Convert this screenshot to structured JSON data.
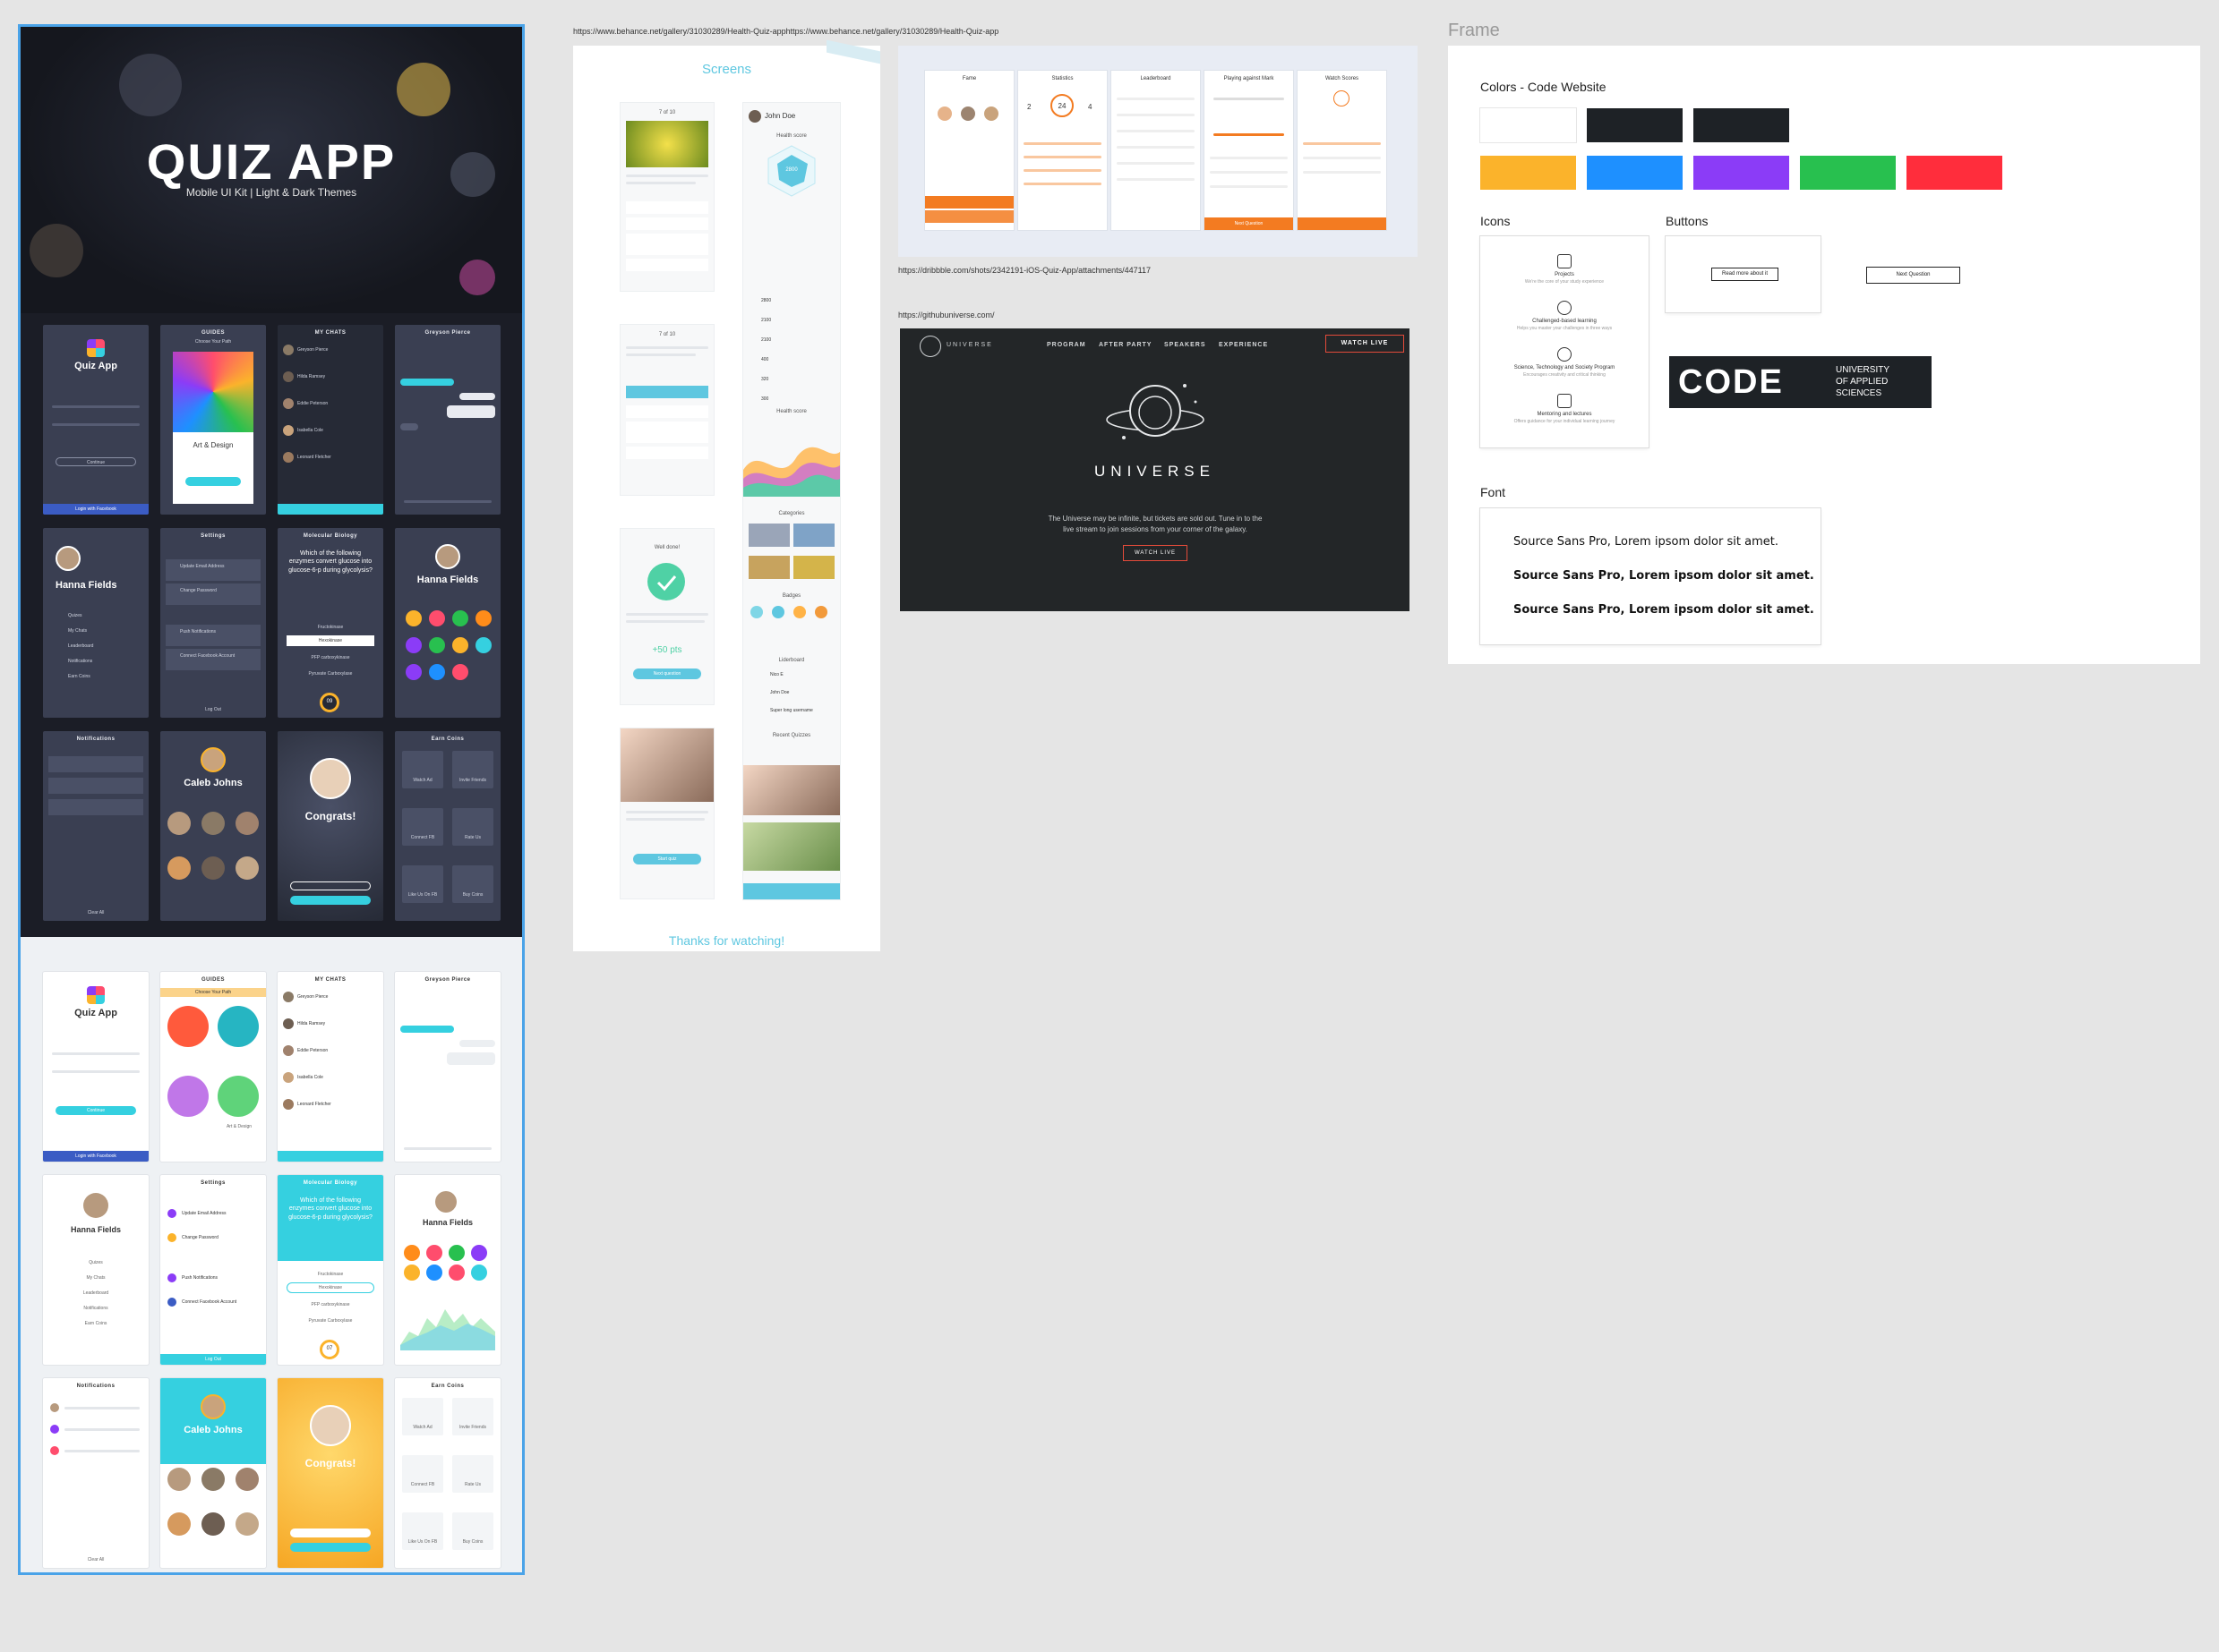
{
  "quiz_board": {
    "title": "QUIZ APP",
    "subtitle": "Mobile UI Kit | Light & Dark Themes",
    "screens": {
      "login_title": "Quiz App",
      "login_button": "Continue",
      "facebook_button": "Login with Facebook",
      "guides": "GUIDES",
      "guides_sub": "Choose Your Path",
      "art_design": "Art & Design",
      "my_chats": "MY CHATS",
      "chat_names": [
        "Greyson Pierce",
        "Hilda Ramsey",
        "Eddie Peterson",
        "Isabella Cole",
        "Leonard Fletcher"
      ],
      "chat_header": "Greyson Pierce",
      "profile_name": "Hanna Fields",
      "menu": [
        "Quizes",
        "My Chats",
        "Leaderboard",
        "Notifications",
        "Earn Coins"
      ],
      "settings": "Settings",
      "settings_items": [
        "Update Email Address",
        "Change Password",
        "Push Notifications",
        "Connect Facebook Account"
      ],
      "log_out": "Log Out",
      "molecular": "Molecular Biology",
      "question": "Which of the following enzymes convert glucose into glucose-6-p during glycolysis?",
      "answers": [
        "Fructokinase",
        "Hexokinase",
        "PFP carboxykinase",
        "Pyruvate Carboxylase"
      ],
      "timer": "09",
      "timer_light": "07",
      "notifications": "Notifications",
      "caleb": "Caleb Johns",
      "congrats": "Congrats!",
      "earn_coins": "Earn Coins",
      "coin_tiles": [
        "Watch Ad",
        "Invite Friends",
        "Connect FB",
        "Rate Us",
        "Like Us On FB",
        "Buy Coins"
      ],
      "clear_all": "Clear All"
    }
  },
  "health_board": {
    "url": "https://www.behance.net/gallery/31030289/Health-Quiz-apphttps://www.behance.net/gallery/31030289/Health-Quiz-app",
    "screens_title": "Screens",
    "thanks": "Thanks for watching!",
    "counter": "7 of 10",
    "user_name": "John Doe",
    "health_score": "Health score",
    "score_value": "2800",
    "well_done": "Well done!",
    "points": "+50 pts",
    "next_question": "Next question",
    "start_quiz": "Start quiz",
    "categories": "Categories",
    "badges": "Badges",
    "leaderboard": "Liderboard",
    "recent_quizzes": "Recent Quizzes",
    "leader_names": [
      "Nico E",
      "John Doe",
      "Super long username"
    ],
    "score_rows": [
      "2800",
      "2100",
      "2100",
      "400",
      "320",
      "300"
    ]
  },
  "dribbble_board": {
    "url": "https://dribbble.com/shots/2342191-iOS-Quiz-App/attachments/447117",
    "screen_titles": [
      "Fame",
      "Statistics",
      "Leaderboard",
      "Playing against Mark",
      "Watch Scores"
    ],
    "stats": [
      "2",
      "24",
      "4"
    ],
    "next_question": "Next Question"
  },
  "universe_board": {
    "url": "https://githubuniverse.com/",
    "logo_text": "UNIVERSE",
    "nav": [
      "PROGRAM",
      "AFTER PARTY",
      "SPEAKERS",
      "EXPERIENCE"
    ],
    "watch_live_nav": "WATCH LIVE",
    "title": "UNIVERSE",
    "description": "The Universe may be infinite, but tickets are sold out. Tune in to the live stream to join sessions from your corner of the galaxy.",
    "watch_live": "WATCH LIVE"
  },
  "frame_board": {
    "label": "Frame",
    "colors_title": "Colors - Code Website",
    "colors": [
      "#ffffff",
      "#1e2226",
      "#1e2226",
      "#fbb32b",
      "#1e90ff",
      "#8b3cf7",
      "#28c04f",
      "#ff2d3c"
    ],
    "icons_title": "Icons",
    "icons": [
      {
        "name": "Projects",
        "desc": "We're the core of your study experience"
      },
      {
        "name": "Challenged-based learning",
        "desc": "Helps you master your challenges in three ways"
      },
      {
        "name": "Science, Technology and Society Program",
        "desc": "Encourages creativity and critical thinking"
      },
      {
        "name": "Mentoring and lectures",
        "desc": "Offers guidance for your individual learning journey"
      }
    ],
    "buttons_title": "Buttons",
    "button_primary": "Read more about it",
    "button_secondary": "Next Question",
    "logo_word": "CODE",
    "logo_line1": "UNIVERSITY",
    "logo_line2": "OF APPLIED",
    "logo_line3": "SCIENCES",
    "font_title": "Font",
    "font_samples": [
      "Source Sans Pro, Lorem ipsom dolor sit amet.",
      "Source Sans Pro, Lorem ipsom dolor sit amet.",
      "Source Sans Pro, Lorem ipsom dolor sit amet."
    ]
  }
}
